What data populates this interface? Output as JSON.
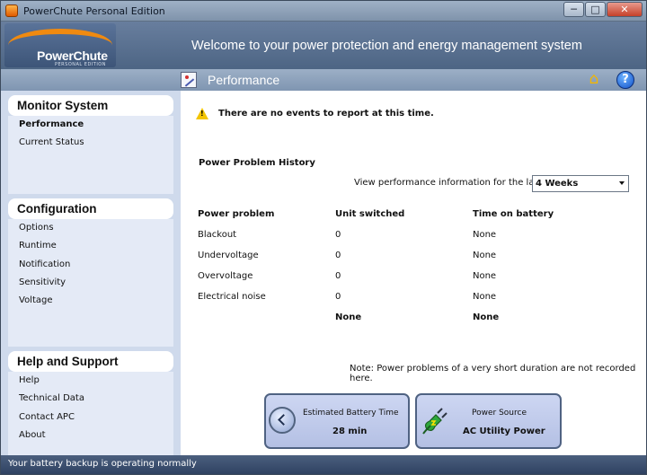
{
  "window": {
    "title": "PowerChute Personal Edition"
  },
  "window_buttons": {
    "minimize": "─",
    "maximize": "□",
    "close": "✕"
  },
  "banner": {
    "logo_name": "PowerChute",
    "logo_sub": "PERSONAL EDITION",
    "welcome": "Welcome to your power protection and energy management system"
  },
  "section": {
    "title": "Performance",
    "help": "?"
  },
  "sidebar": {
    "groups": [
      {
        "title": "Monitor System",
        "items": [
          "Performance",
          "Current Status"
        ]
      },
      {
        "title": "Configuration",
        "items": [
          "Options",
          "Runtime",
          "Notification",
          "Sensitivity",
          "Voltage"
        ]
      },
      {
        "title": "Help and Support",
        "items": [
          "Help",
          "Technical Data",
          "Contact APC",
          "About"
        ]
      }
    ]
  },
  "main": {
    "events_message": "There are no events to report at this time.",
    "history_title": "Power Problem History",
    "period_label": "View performance information for the last",
    "period_value": "4 Weeks",
    "columns": [
      "Power problem",
      "Unit switched",
      "Time on battery"
    ],
    "rows": [
      [
        "Blackout",
        "0",
        "None"
      ],
      [
        "Undervoltage",
        "0",
        "None"
      ],
      [
        "Overvoltage",
        "0",
        "None"
      ],
      [
        "Electrical noise",
        "0",
        "None"
      ]
    ],
    "totals": [
      "None",
      "None"
    ],
    "note": "Note: Power problems of a very short duration are not recorded here."
  },
  "cards": {
    "battery": {
      "label": "Estimated Battery Time",
      "value": "28 min"
    },
    "power": {
      "label": "Power Source",
      "value": "AC Utility Power"
    }
  },
  "status": {
    "text": "Your battery backup is operating normally"
  },
  "colors": {
    "accent": "#f08a10",
    "header": "#4d6584",
    "sidebar": "#cfdaec"
  }
}
